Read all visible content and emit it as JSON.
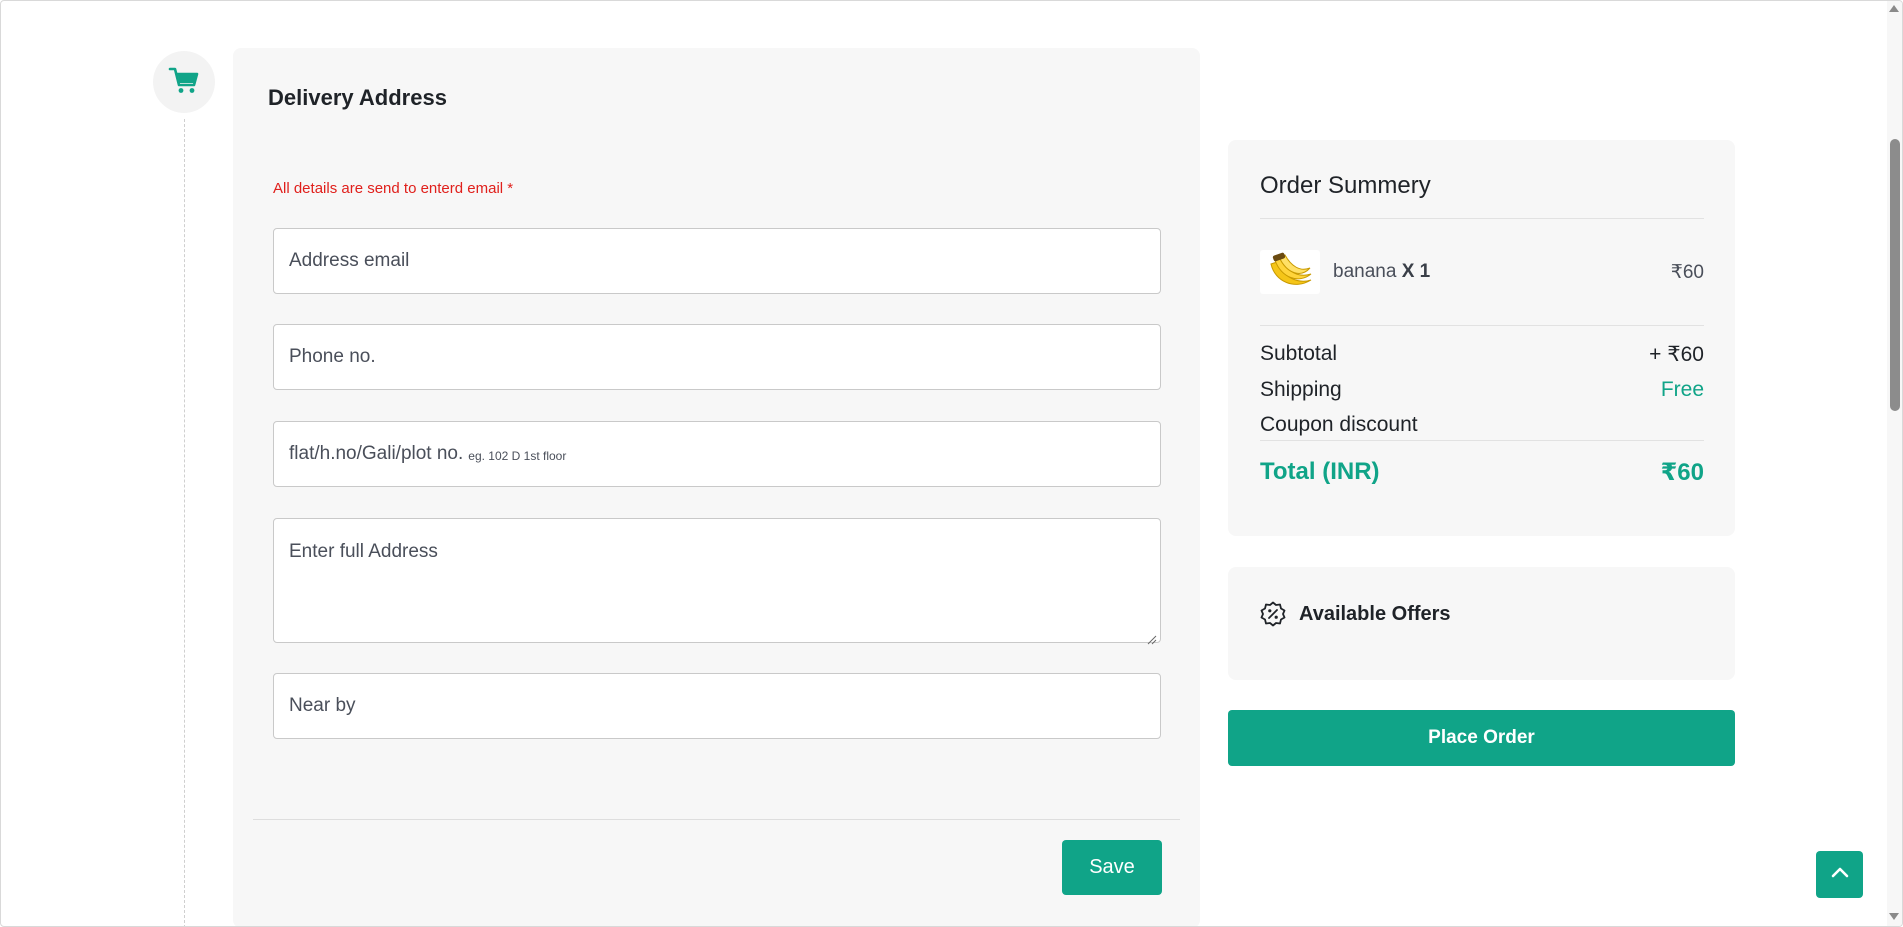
{
  "delivery": {
    "title": "Delivery Address",
    "notice": "All details are send to enterd email *",
    "fields": {
      "email_placeholder": "Address email",
      "phone_placeholder": "Phone no.",
      "flat_placeholder": "flat/h.no/Gali/plot no.",
      "flat_hint": "eg. 102 D 1st floor",
      "address_placeholder": "Enter full Address",
      "nearby_placeholder": "Near by"
    },
    "save_label": "Save"
  },
  "summary": {
    "title": "Order Summery",
    "items": [
      {
        "name": "banana",
        "qty": "X 1",
        "price": "₹60",
        "icon": "banana-image"
      }
    ],
    "subtotal_label": "Subtotal",
    "subtotal_value": "+ ₹60",
    "shipping_label": "Shipping",
    "shipping_value": "Free",
    "coupon_label": "Coupon discount",
    "total_label": "Total (INR)",
    "total_value": "₹60"
  },
  "offers": {
    "label": "Available Offers",
    "icon": "discount-badge-icon"
  },
  "place_order_label": "Place Order",
  "icons": {
    "step_icon": "shopping-cart-icon",
    "back_to_top": "chevron-up-icon"
  },
  "colors": {
    "accent": "#10a488",
    "notice": "#e0201c",
    "card_bg": "#f7f7f7"
  }
}
